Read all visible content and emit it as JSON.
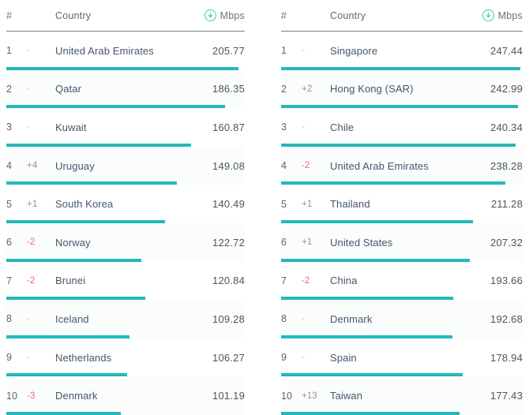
{
  "chart_data": {
    "type": "bar",
    "title": "",
    "xlabel": "",
    "ylabel": "Mbps",
    "grid": false,
    "legend": "none",
    "panels": [
      {
        "name": "left-ranking",
        "columns": [
          "#",
          "",
          "Country",
          "Mbps"
        ],
        "max_value": 205.77,
        "categories": [
          "United Arab Emirates",
          "Qatar",
          "Kuwait",
          "Uruguay",
          "South Korea",
          "Norway",
          "Brunei",
          "Iceland",
          "Netherlands",
          "Denmark"
        ],
        "values": [
          205.77,
          186.35,
          160.87,
          149.08,
          140.49,
          122.72,
          120.84,
          109.28,
          106.27,
          101.19
        ]
      },
      {
        "name": "right-ranking",
        "columns": [
          "#",
          "",
          "Country",
          "Mbps"
        ],
        "max_value": 247.44,
        "categories": [
          "Singapore",
          "Hong Kong (SAR)",
          "Chile",
          "United Arab Emirates",
          "Thailand",
          "United States",
          "China",
          "Denmark",
          "Spain",
          "Taiwan"
        ],
        "values": [
          247.44,
          242.99,
          240.34,
          238.28,
          211.28,
          207.32,
          193.66,
          192.68,
          178.94,
          177.43
        ]
      }
    ]
  },
  "colors": {
    "bar": "#24b8b8",
    "accent_icon": "#38c7b4",
    "negative": "#f2637e",
    "country_text": "#46566b",
    "value_text": "#4c555f"
  },
  "panels": [
    {
      "header": {
        "rank": "#",
        "change": "",
        "country": "Country",
        "speed": "Mbps",
        "speed_icon": "download-arrow-circle-icon"
      },
      "rows": [
        {
          "rank": "1",
          "change": "-",
          "change_kind": "flat",
          "country": "United Arab Emirates",
          "speed": "205.77",
          "bar_pct": 97.5
        },
        {
          "rank": "2",
          "change": "-",
          "change_kind": "flat",
          "country": "Qatar",
          "speed": "186.35",
          "bar_pct": 91.8
        },
        {
          "rank": "3",
          "change": "-",
          "change_kind": "flat",
          "country": "Kuwait",
          "speed": "160.87",
          "bar_pct": 77.5
        },
        {
          "rank": "4",
          "change": "+4",
          "change_kind": "pos",
          "country": "Uruguay",
          "speed": "149.08",
          "bar_pct": 71.4
        },
        {
          "rank": "5",
          "change": "+1",
          "change_kind": "pos",
          "country": "South Korea",
          "speed": "140.49",
          "bar_pct": 66.7
        },
        {
          "rank": "6",
          "change": "-2",
          "change_kind": "neg",
          "country": "Norway",
          "speed": "122.72",
          "bar_pct": 56.6
        },
        {
          "rank": "7",
          "change": "-2",
          "change_kind": "neg",
          "country": "Brunei",
          "speed": "120.84",
          "bar_pct": 58.2
        },
        {
          "rank": "8",
          "change": "-",
          "change_kind": "flat",
          "country": "Iceland",
          "speed": "109.28",
          "bar_pct": 51.6
        },
        {
          "rank": "9",
          "change": "-",
          "change_kind": "flat",
          "country": "Netherlands",
          "speed": "106.27",
          "bar_pct": 50.6
        },
        {
          "rank": "10",
          "change": "-3",
          "change_kind": "neg",
          "country": "Denmark",
          "speed": "101.19",
          "bar_pct": 48.0
        }
      ]
    },
    {
      "header": {
        "rank": "#",
        "change": "",
        "country": "Country",
        "speed": "Mbps",
        "speed_icon": "download-arrow-circle-icon"
      },
      "rows": [
        {
          "rank": "1",
          "change": "-",
          "change_kind": "flat",
          "country": "Singapore",
          "speed": "247.44",
          "bar_pct": 99.0
        },
        {
          "rank": "2",
          "change": "+2",
          "change_kind": "pos",
          "country": "Hong Kong (SAR)",
          "speed": "242.99",
          "bar_pct": 98.0
        },
        {
          "rank": "3",
          "change": "-",
          "change_kind": "flat",
          "country": "Chile",
          "speed": "240.34",
          "bar_pct": 97.2
        },
        {
          "rank": "4",
          "change": "-2",
          "change_kind": "neg",
          "country": "United Arab Emirates",
          "speed": "238.28",
          "bar_pct": 92.8
        },
        {
          "rank": "5",
          "change": "+1",
          "change_kind": "pos",
          "country": "Thailand",
          "speed": "211.28",
          "bar_pct": 79.3
        },
        {
          "rank": "6",
          "change": "+1",
          "change_kind": "pos",
          "country": "United States",
          "speed": "207.32",
          "bar_pct": 78.0
        },
        {
          "rank": "7",
          "change": "-2",
          "change_kind": "neg",
          "country": "China",
          "speed": "193.66",
          "bar_pct": 71.3
        },
        {
          "rank": "8",
          "change": "-",
          "change_kind": "flat",
          "country": "Denmark",
          "speed": "192.68",
          "bar_pct": 71.0
        },
        {
          "rank": "9",
          "change": "-",
          "change_kind": "flat",
          "country": "Spain",
          "speed": "178.94",
          "bar_pct": 75.0
        },
        {
          "rank": "10",
          "change": "+13",
          "change_kind": "pos",
          "country": "Taiwan",
          "speed": "177.43",
          "bar_pct": 74.0
        }
      ]
    }
  ]
}
